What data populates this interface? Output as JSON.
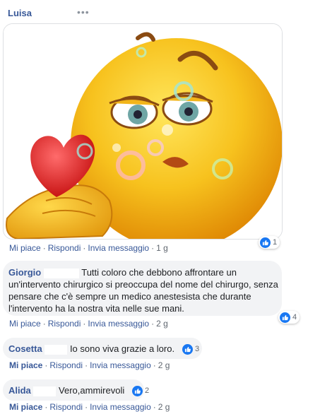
{
  "post": {
    "author": "Luisa",
    "more_icon": "ellipsis-icon",
    "gif": {
      "description_icon": "kiss-emoji-heart"
    },
    "actions": {
      "like": "Mi piace",
      "reply": "Rispondi",
      "message": "Invia messaggio",
      "time": "1 g",
      "reactions": "1"
    }
  },
  "comments": [
    {
      "author": "Giorgio",
      "text": "Tutti coloro che debbono affrontare un un'intervento chirurgico si preoccupa del nome del chirurgo, senza pensare che c'è sempre un medico anestesista che durante l'intervento ha la nostra vita nelle sue mani.",
      "line1": "Tutti coloro che debbono affrontare un",
      "line2": "un'intervento chirurgico si preoccupa del nome del chirurgo, senza",
      "line3": "pensare che c'è sempre un medico anestesista che durante",
      "line4": "l'intervento ha la nostra vita nelle sue mani.",
      "like": "Mi piace",
      "reply": "Rispondi",
      "message": "Invia messaggio",
      "time": "2 g",
      "reactions": "4"
    },
    {
      "author": "Cosetta",
      "text": "Io sono viva grazie a loro.",
      "like": "Mi piace",
      "reply": "Rispondi",
      "message": "Invia messaggio",
      "time": "2 g",
      "reactions": "3"
    },
    {
      "author": "Alida",
      "text": "Vero,ammirevoli",
      "like": "Mi piace",
      "reply": "Rispondi",
      "message": "Invia messaggio",
      "time": "2 g",
      "reactions": "2"
    }
  ],
  "colors": {
    "link": "#385898",
    "like_blue": "#1877f2",
    "bubble": "#f2f3f5",
    "meta_gray": "#606770"
  }
}
